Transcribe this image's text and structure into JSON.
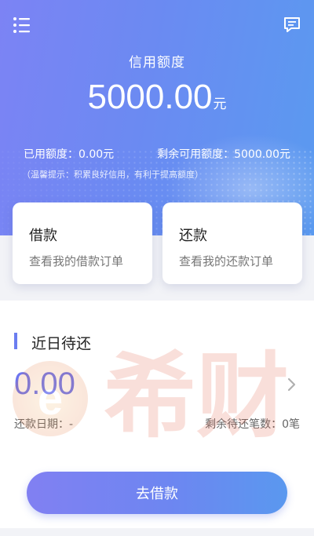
{
  "header": {
    "menu_icon": "list-menu-icon",
    "message_icon": "message-icon"
  },
  "credit": {
    "label": "信用额度",
    "amount": "5000.00",
    "unit": "元",
    "used": "已用额度：0.00元",
    "remaining": "剩余可用额度：5000.00元",
    "tip": "（温馨提示：积累良好信用，有利于提高额度）"
  },
  "cards": {
    "borrow": {
      "title": "借款",
      "subtitle": "查看我的借款订单"
    },
    "repay": {
      "title": "还款",
      "subtitle": "查看我的还款订单"
    }
  },
  "repayment": {
    "heading": "近日待还",
    "amount": "0.00",
    "date": "还款日期：-",
    "remaining_count": "剩余待还笔数：0笔",
    "chevron_icon": "chevron-right-icon"
  },
  "action": {
    "borrow_button": "去借款"
  },
  "watermark": {
    "text": "希财"
  },
  "colors": {
    "primary": "#6b7df0",
    "amount": "#6e75ee",
    "watermark": "#e0553a"
  }
}
